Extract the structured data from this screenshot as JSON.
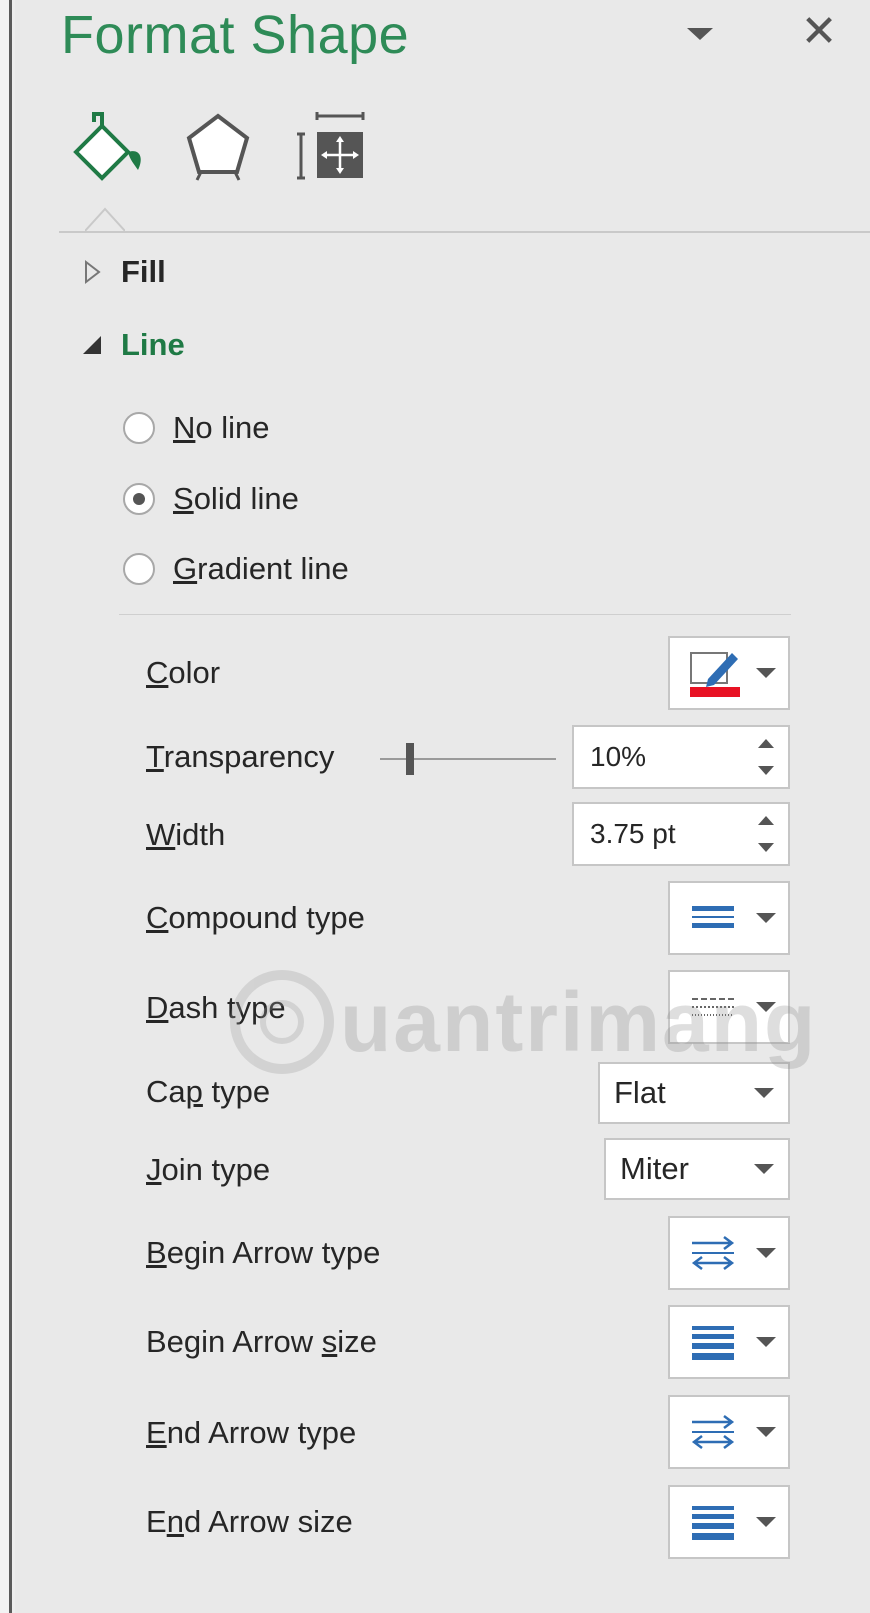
{
  "pane": {
    "title": "Format Shape",
    "close_glyph": "✕"
  },
  "tabs": [
    {
      "name": "fill-line-tab",
      "icon": "paint-bucket-icon",
      "selected": true
    },
    {
      "name": "effects-tab",
      "icon": "pentagon-icon",
      "selected": false
    },
    {
      "name": "size-properties-tab",
      "icon": "size-properties-icon",
      "selected": false
    }
  ],
  "sections": {
    "fill": {
      "label": "Fill",
      "expanded": false
    },
    "line": {
      "label": "Line",
      "expanded": true
    }
  },
  "line_options": {
    "no_line": {
      "underline": "N",
      "rest": "o line",
      "checked": false
    },
    "solid_line": {
      "underline": "S",
      "rest": "olid line",
      "checked": true
    },
    "gradient_line": {
      "underline": "G",
      "rest": "radient line",
      "checked": false
    }
  },
  "props": {
    "color": {
      "u": "C",
      "rest": "olor",
      "swatch": "#e81123"
    },
    "transparency": {
      "u": "T",
      "rest": "ransparency",
      "value": "10%",
      "level": 0.1
    },
    "width": {
      "u": "W",
      "rest": "idth",
      "value": "3.75 pt"
    },
    "compound": {
      "u": "C",
      "rest": "ompound type"
    },
    "dash": {
      "u": "D",
      "rest": "ash type"
    },
    "cap": {
      "pre": "Ca",
      "u": "p",
      "rest": " type",
      "value": "Flat"
    },
    "join": {
      "u": "J",
      "rest": "oin type",
      "value": "Miter"
    },
    "begin_arrow_type": {
      "u": "B",
      "rest": "egin Arrow type"
    },
    "begin_arrow_size": {
      "pre": "Begin Arrow ",
      "u": "s",
      "rest": "ize"
    },
    "end_arrow_type": {
      "u": "E",
      "rest": "nd Arrow type"
    },
    "end_arrow_size": {
      "pre": "E",
      "u": "n",
      "rest": "d Arrow size"
    }
  },
  "colors": {
    "accent_green": "#2e8b57",
    "icon_blue": "#2e6db4",
    "color_swatch_red": "#e81123"
  },
  "watermark": {
    "text": "uantrimang"
  }
}
